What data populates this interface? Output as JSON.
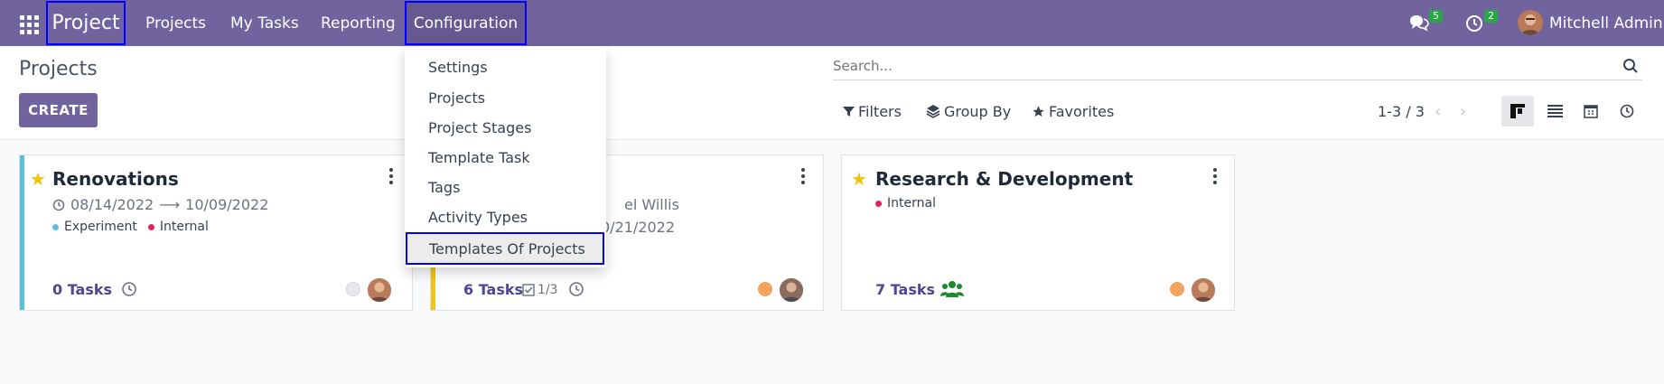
{
  "navbar": {
    "brand": "Project",
    "menu": [
      "Projects",
      "My Tasks",
      "Reporting",
      "Configuration"
    ],
    "messages_count": "5",
    "activities_count": "2",
    "user": "Mitchell Admin"
  },
  "control": {
    "title": "Projects",
    "create_label": "CREATE",
    "search_placeholder": "Search...",
    "filters_label": "Filters",
    "groupby_label": "Group By",
    "favorites_label": "Favorites",
    "pager": "1-3 / 3"
  },
  "dropdown": {
    "items": [
      "Settings",
      "Projects",
      "Project Stages",
      "Template Task",
      "Tags",
      "Activity Types",
      "Templates Of Projects"
    ]
  },
  "cards": [
    {
      "title": "Renovations",
      "start": "08/14/2022",
      "end": "10/09/2022",
      "tags": [
        "Experiment",
        "Internal"
      ],
      "tasks": "0 Tasks",
      "bar_color": "#5bc0de"
    },
    {
      "partner_fragment": "el Willis",
      "date_fragment": "0/21/2022",
      "tasks": "6 Tasks",
      "subtasks": "1/3",
      "bar_color": "#f0c419"
    },
    {
      "title": "Research & Development",
      "tags": [
        "Internal"
      ],
      "tasks": "7 Tasks"
    }
  ],
  "colors": {
    "navbar": "#71639e",
    "highlight_border": "#0000ff",
    "star": "#f3c00e",
    "tag_experiment": "#5bc0de",
    "tag_internal": "#e0245e",
    "status_orange": "#f0a45f"
  }
}
